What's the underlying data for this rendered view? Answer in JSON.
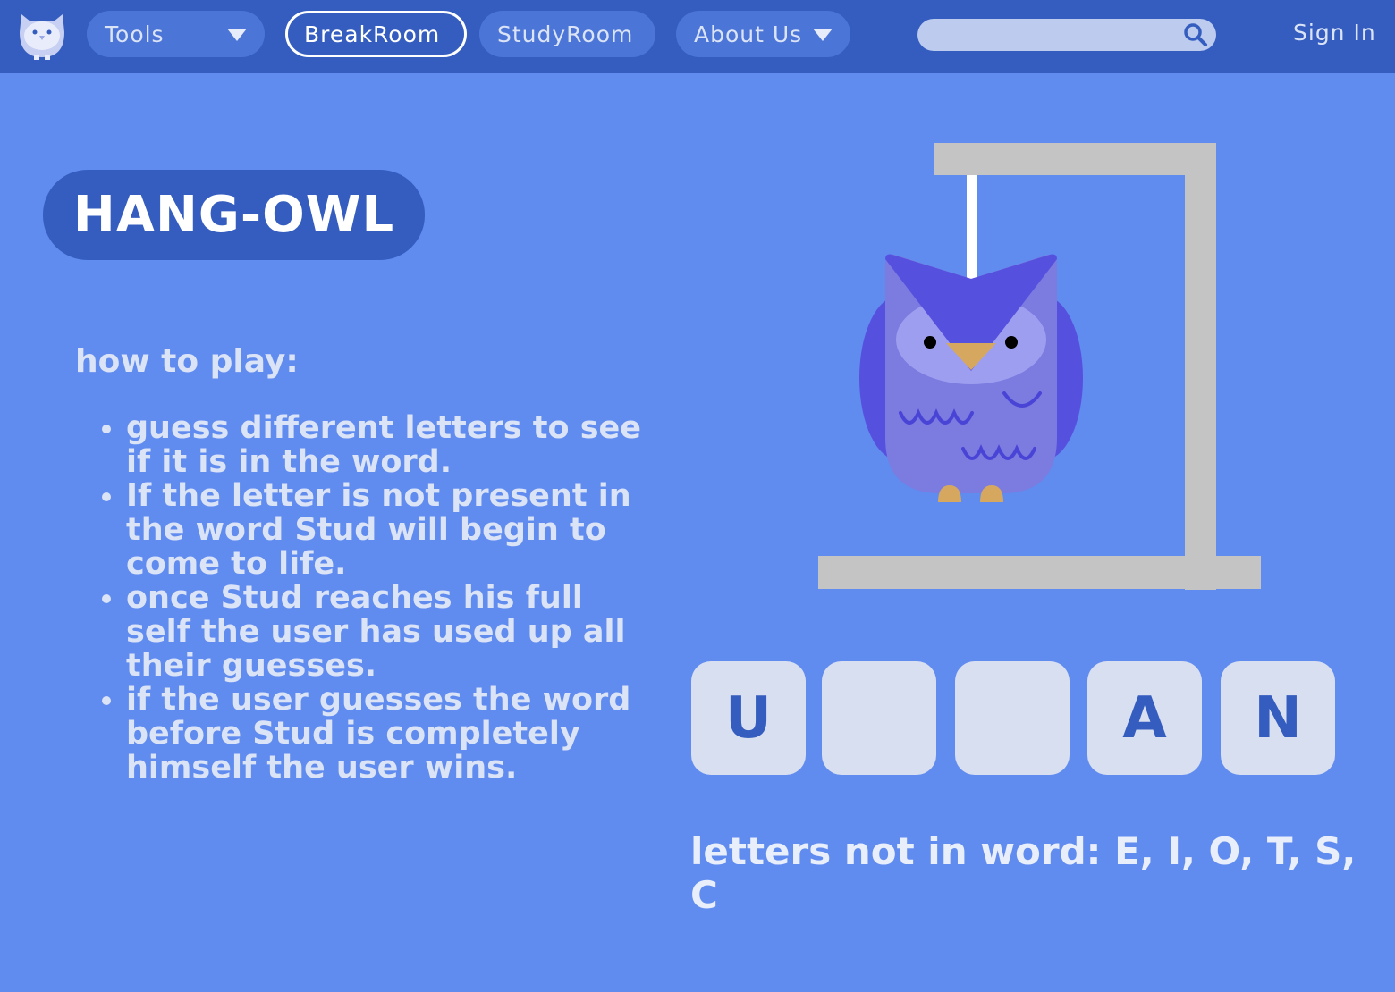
{
  "nav": {
    "tools": "Tools",
    "breakroom": "BreakRoom",
    "studyroom": "StudyRoom",
    "about": "About Us",
    "search_value": "",
    "signin": "Sign In"
  },
  "game": {
    "title": "HANG-OWL",
    "howto_title": "how to play:",
    "rules": [
      "guess different letters to see if it is in the word.",
      "If the letter is not present in the word Stud will begin to come to life.",
      "once Stud reaches his full self the user has used up all their guesses.",
      "if the user guesses the word before Stud is completely himself the user wins."
    ],
    "tiles": [
      "U",
      "",
      "",
      "A",
      "N"
    ],
    "wrong_letters": "letters not in word: E, I, O, T, S, C"
  },
  "colors": {
    "background": "#608bef",
    "navbar": "#345dbf",
    "tile": "#d8dff0",
    "gallows": "#c4c4c4",
    "owl_body": "#7b7be0",
    "owl_wing": "#5650de"
  }
}
